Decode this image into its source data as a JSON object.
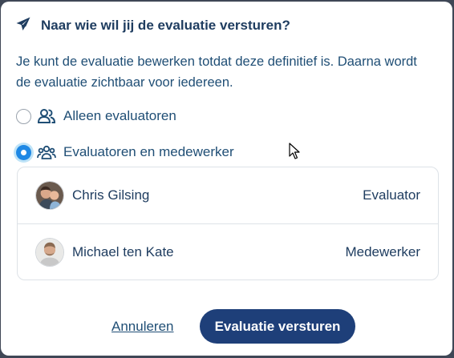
{
  "dialog": {
    "title": "Naar wie wil jij de evaluatie versturen?",
    "title_icon": "paper-plane-icon",
    "description": "Je kunt de evaluatie bewerken totdat deze definitief is. Daarna wordt de evaluatie zichtbaar voor iedereen."
  },
  "options": [
    {
      "label": "Alleen evaluatoren",
      "icon": "user-group-icon",
      "selected": false
    },
    {
      "label": "Evaluatoren en medewerker",
      "icon": "users-icon",
      "selected": true
    }
  ],
  "recipients": [
    {
      "name": "Chris Gilsing",
      "role": "Evaluator"
    },
    {
      "name": "Michael ten Kate",
      "role": "Medewerker"
    }
  ],
  "actions": {
    "cancel_label": "Annuleren",
    "send_label": "Evaluatie versturen"
  },
  "colors": {
    "primary": "#1e3f79",
    "text": "#1f4e75",
    "radio_selected": "#1e88e5"
  }
}
